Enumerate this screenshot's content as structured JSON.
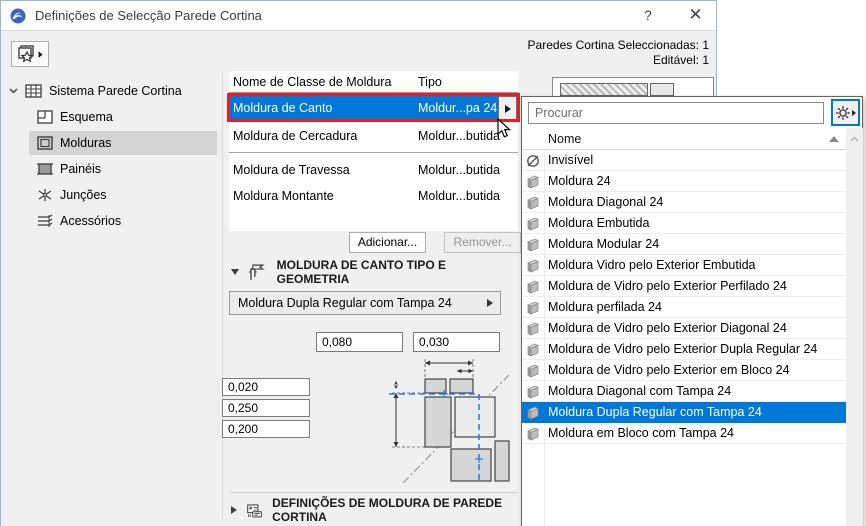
{
  "window": {
    "title": "Definições de Selecção Parede Cortina",
    "help_label": "?",
    "close_label": "✕"
  },
  "header": {
    "selected_info": "Paredes Cortina Seleccionadas: 1",
    "editable_info": "Editável: 1"
  },
  "sidebar": {
    "root_label": "Sistema Parede Cortina",
    "items": [
      {
        "label": "Esquema"
      },
      {
        "label": "Molduras",
        "selected": true
      },
      {
        "label": "Painéis"
      },
      {
        "label": "Junções"
      },
      {
        "label": "Acessórios"
      }
    ]
  },
  "classes_table": {
    "columns": [
      "Nome de Classe de Moldura",
      "Tipo"
    ],
    "rows": [
      {
        "name": "Moldura de Canto",
        "type": "Moldur...pa 24",
        "selected": true
      },
      {
        "name": "Moldura de Cercadura",
        "type": "Moldur...butida"
      },
      {
        "name": "Moldura de Travessa",
        "type": "Moldur...butida"
      },
      {
        "name": "Moldura Montante",
        "type": "Moldur...butida"
      }
    ]
  },
  "actions": {
    "add_label": "Adicionar...",
    "remove_label": "Remover..."
  },
  "geometry_section": {
    "title": "MOLDURA DE CANTO TIPO E GEOMETRIA",
    "type_selector_value": "Moldura Dupla Regular com Tampa 24",
    "fields": {
      "width_a": "0,080",
      "width_b": "0,030",
      "depth_a": "0,020",
      "depth_b": "0,250",
      "depth_c": "0,200"
    }
  },
  "bottom_section": {
    "title": "DEFINIÇÕES DE MOLDURA DE PAREDE CORTINA"
  },
  "popup": {
    "search_placeholder": "Procurar",
    "column_header": "Nome",
    "items": [
      {
        "label": "Invisível",
        "icon": "invisible"
      },
      {
        "label": "Moldura 24",
        "icon": "frame"
      },
      {
        "label": "Moldura Diagonal 24",
        "icon": "frame"
      },
      {
        "label": "Moldura Embutida",
        "icon": "frame"
      },
      {
        "label": "Moldura Modular 24",
        "icon": "frame"
      },
      {
        "label": "Moldura Vidro pelo Exterior Embutida",
        "icon": "frame"
      },
      {
        "label": "Moldura de Vidro pelo Exterior Perfilado 24",
        "icon": "frame"
      },
      {
        "label": "Moldura perfilada 24",
        "icon": "frame"
      },
      {
        "label": "Moldura de Vidro pelo Exterior Diagonal 24",
        "icon": "frame"
      },
      {
        "label": "Moldura de Vidro pelo Exterior Dupla Regular 24",
        "icon": "frame"
      },
      {
        "label": "Moldura de Vidro pelo Exterior em Bloco 24",
        "icon": "frame"
      },
      {
        "label": "Moldura Diagonal com Tampa 24",
        "icon": "frame"
      },
      {
        "label": "Moldura Dupla Regular com Tampa 24",
        "icon": "frame",
        "selected": true
      },
      {
        "label": "Moldura em Bloco com Tampa 24",
        "icon": "frame"
      }
    ]
  },
  "colors": {
    "selection_blue": "#0078d7",
    "annotation_red": "#ec1c24",
    "dialog_bg": "#f0f0f0"
  }
}
